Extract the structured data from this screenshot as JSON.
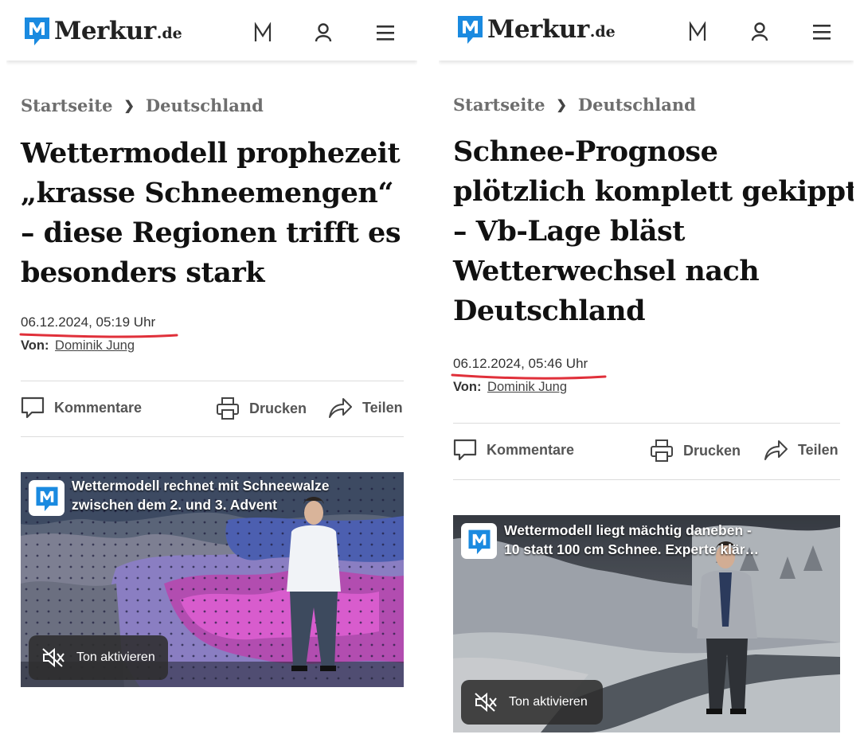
{
  "brand": {
    "name": "Merkur",
    "tld": ".de",
    "logo_blue": "#1a8ae0",
    "red_mark": "#e0303a"
  },
  "header_icons": [
    "merkur-m-icon",
    "user-icon",
    "menu-icon"
  ],
  "articles": [
    {
      "breadcrumb": [
        "Startseite",
        "Deutschland"
      ],
      "headline": [
        "Wettermodell prophezeit",
        "„krasse Schneemengen“",
        "– diese Regionen trifft es",
        "besonders stark"
      ],
      "date": "06.12.2024, 05:19 Uhr",
      "byline_label": "Von:",
      "author": "Dominik Jung",
      "actions": {
        "comments": "Kommentare",
        "print": "Drucken",
        "share": "Teilen"
      },
      "video": {
        "title": [
          "Wettermodell rechnet mit Schneewalze",
          "zwischen dem 2. und 3. Advent"
        ],
        "sound_label": "Ton aktivieren"
      }
    },
    {
      "breadcrumb": [
        "Startseite",
        "Deutschland"
      ],
      "headline": [
        "Schnee-Prognose",
        "plötzlich komplett gekippt",
        "– Vb-Lage bläst",
        "Wetterwechsel nach",
        "Deutschland"
      ],
      "date": "06.12.2024, 05:46 Uhr",
      "byline_label": "Von:",
      "author": "Dominik Jung",
      "actions": {
        "comments": "Kommentare",
        "print": "Drucken",
        "share": "Teilen"
      },
      "video": {
        "title": [
          "Wettermodell liegt mächtig daneben -",
          "10 statt 100 cm Schnee. Experte klär…"
        ],
        "sound_label": "Ton aktivieren"
      }
    }
  ]
}
